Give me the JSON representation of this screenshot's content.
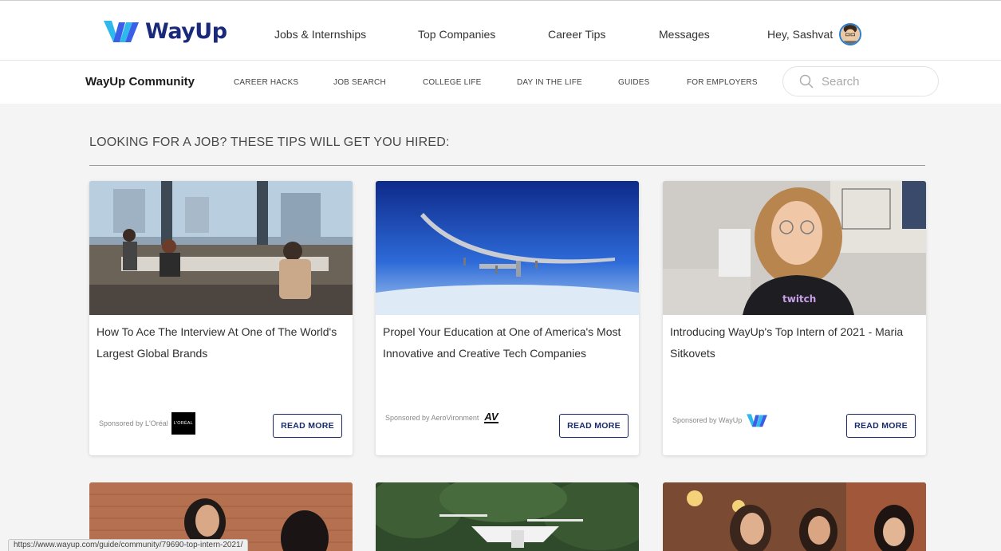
{
  "header": {
    "logo_text": "WayUp",
    "nav": [
      "Jobs & Internships",
      "Top Companies",
      "Career Tips",
      "Messages"
    ],
    "greeting": "Hey, Sashvat"
  },
  "subnav": {
    "title": "WayUp Community",
    "items": [
      "CAREER HACKS",
      "JOB SEARCH",
      "COLLEGE LIFE",
      "DAY IN THE LIFE",
      "GUIDES",
      "FOR EMPLOYERS"
    ],
    "search_placeholder": "Search"
  },
  "section": {
    "title": "LOOKING FOR A JOB? THESE TIPS WILL GET YOU HIRED:"
  },
  "cards": [
    {
      "title": "How To Ace The Interview At One of The World's Largest Global Brands",
      "sponsor": "Sponsored by L'Oréal",
      "sponsor_logo_text": "L'ORÉAL",
      "button": "READ MORE"
    },
    {
      "title": "Propel Your Education at One of America's Most Innovative and Creative Tech Companies",
      "sponsor": "Sponsored by AeroVironment",
      "sponsor_logo_text": "AV",
      "button": "READ MORE"
    },
    {
      "title": "Introducing WayUp's Top Intern of 2021 - Maria Sitkovets",
      "sponsor": "Sponsored by WayUp",
      "sponsor_logo_text": "",
      "button": "READ MORE"
    }
  ],
  "status_bar": {
    "url": "https://www.wayup.com/guide/community/79690-top-intern-2021/"
  },
  "colors": {
    "brand_navy": "#1a2a7a",
    "brand_cyan": "#2fb8ec",
    "brand_blue": "#3a5ee8"
  }
}
